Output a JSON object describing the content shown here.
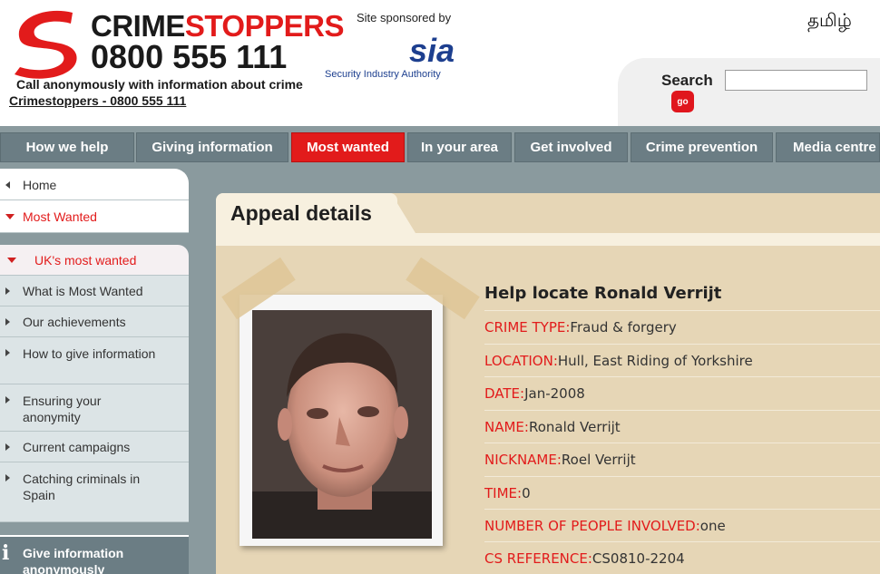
{
  "header": {
    "logo_name_black": "CRIME",
    "logo_name_red": "STOPPERS",
    "logo_phone": "0800 555 111",
    "tagline": "Call anonymously with information about crime",
    "home_link": "Crimestoppers - 0800 555 111",
    "sponsor_label": "Site sponsored by",
    "sponsor_logo_text": "sia",
    "sponsor_name": "Security Industry Authority",
    "language_link": "தமிழ்",
    "search_label": "Search",
    "search_value": "",
    "search_go": "go"
  },
  "nav": {
    "tabs": [
      {
        "label": "How we help"
      },
      {
        "label": "Giving information"
      },
      {
        "label": "Most wanted"
      },
      {
        "label": "In your area"
      },
      {
        "label": "Get involved"
      },
      {
        "label": "Crime prevention"
      },
      {
        "label": "Media centre"
      }
    ],
    "active_tab": "Most wanted"
  },
  "sidebar": {
    "home": "Home",
    "most_wanted": "Most Wanted",
    "uk_most_wanted": "UK's most wanted",
    "items": [
      {
        "label": "What is Most Wanted"
      },
      {
        "label": "Our achievements"
      },
      {
        "label": "How to give information"
      },
      {
        "label": "Ensuring your anonymity"
      },
      {
        "label": "Current campaigns"
      },
      {
        "label": "Catching criminals in Spain"
      }
    ],
    "give_info": "Give information anonymously"
  },
  "appeal": {
    "tab_title": "Appeal details",
    "heading": "Help locate Ronald Verrijt",
    "details": [
      {
        "label": "CRIME TYPE:",
        "value": " Fraud & forgery"
      },
      {
        "label": "LOCATION:",
        "value": " Hull, East Riding of Yorkshire"
      },
      {
        "label": "DATE:",
        "value": " Jan-2008"
      },
      {
        "label": "NAME:",
        "value": " Ronald Verrijt"
      },
      {
        "label": "NICKNAME:",
        "value": "Roel Verrijt"
      },
      {
        "label": "TIME:",
        "value": " 0"
      },
      {
        "label": "NUMBER OF PEOPLE INVOLVED:",
        "value": " one"
      },
      {
        "label": "CS REFERENCE:",
        "value": " CS0810-2204"
      }
    ]
  },
  "colors": {
    "brand_red": "#e21b1b",
    "nav_grey": "#6b7d84",
    "panel_tan": "#e6d6b6"
  }
}
